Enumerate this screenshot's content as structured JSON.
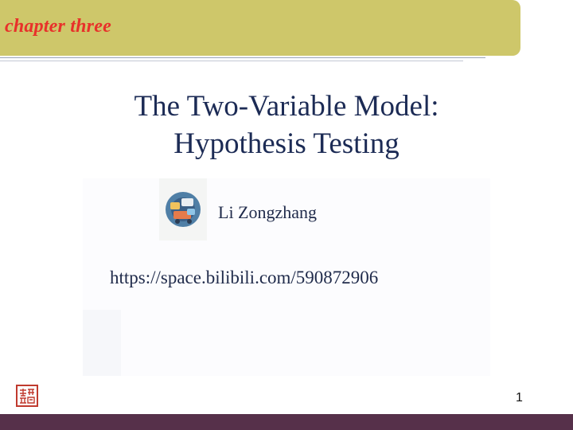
{
  "header": {
    "chapter_label": "chapter three"
  },
  "slide": {
    "title_line1": "The Two-Variable Model:",
    "title_line2": "Hypothesis Testing",
    "author": "Li Zongzhang",
    "url": "https://space.bilibili.com/590872906",
    "page_number": "1"
  },
  "colors": {
    "header_bar": "#cec76a",
    "chapter_label": "#e8312a",
    "title": "#1c2b55",
    "footer_bar": "#56304a"
  }
}
